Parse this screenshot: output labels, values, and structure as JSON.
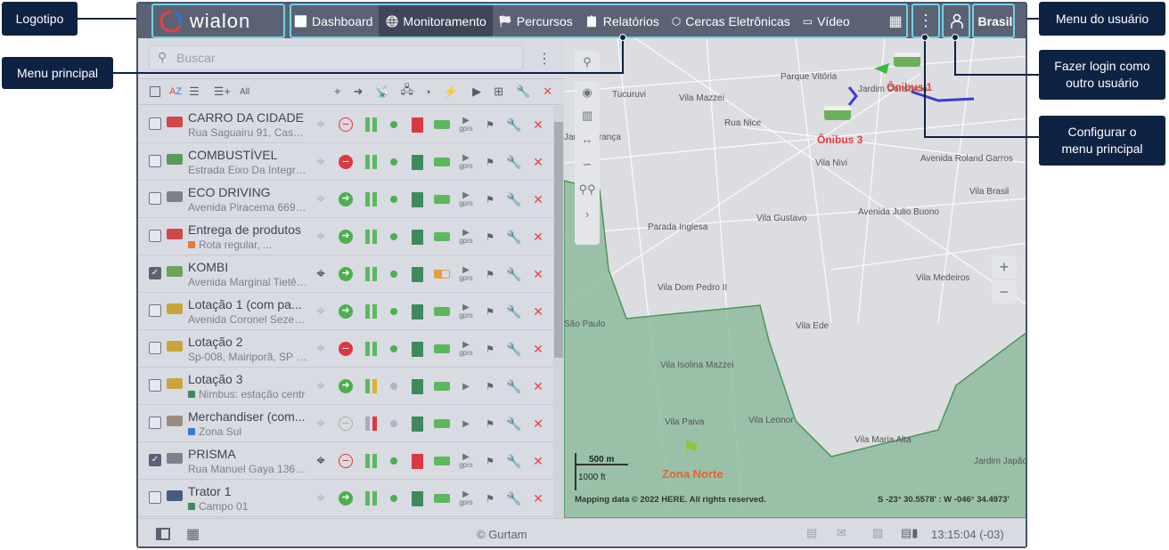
{
  "header": {
    "logo_text": "wialon",
    "nav": [
      {
        "label": "Dashboard",
        "icon": "bar-chart-icon"
      },
      {
        "label": "Monitoramento",
        "icon": "globe-icon",
        "active": true
      },
      {
        "label": "Percursos",
        "icon": "checkered-flag-icon"
      },
      {
        "label": "Relatórios",
        "icon": "report-icon"
      },
      {
        "label": "Cercas Eletrônicas",
        "icon": "geofence-icon"
      },
      {
        "label": "Vídeo",
        "icon": "video-icon"
      }
    ],
    "user": "Brasil"
  },
  "callouts": {
    "logo": "Logotipo",
    "main_menu": "Menu principal",
    "user_menu": "Menu do usuário",
    "login_as": "Fazer login como outro usuário",
    "configure": "Configurar o menu principal"
  },
  "search": {
    "placeholder": "Buscar"
  },
  "units": [
    {
      "name": "CARRO DA CIDADE",
      "address": "Rua Saguairu 91, Casa ...",
      "checked": false,
      "icon_color": "#d04848",
      "arrow": "stop-outline",
      "bars": "green",
      "dot": "green",
      "square": "#d9393f",
      "battery": "full",
      "gprs": true
    },
    {
      "name": "COMBUSTÍVEL",
      "address": "Estrada Eixo Da Integra...",
      "checked": false,
      "icon_color": "#5a9a5a",
      "arrow": "stop-filled",
      "bars": "green",
      "dot": "green",
      "square": "#3f8a5c",
      "battery": "full",
      "gprs": true
    },
    {
      "name": "ECO DRIVING",
      "address": "Avenida Piracema 669, ...",
      "checked": false,
      "icon_color": "#7a8290",
      "arrow": "go",
      "bars": "green",
      "dot": "green",
      "square": "#3f8a5c",
      "battery": "full",
      "gprs": true
    },
    {
      "name": "Entrega de produtos",
      "address": "Rota regular, ...",
      "marker": "#e07b39",
      "checked": false,
      "icon_color": "#d04848",
      "arrow": "go",
      "bars": "green",
      "dot": "green",
      "square": "#3f8a5c",
      "battery": "full",
      "gprs": true
    },
    {
      "name": "KOMBI",
      "address": "Avenida Marginal Tietê,...",
      "checked": true,
      "icon_color": "#6aa35a",
      "arrow": "go",
      "bars": "green",
      "dot": "green",
      "square": "#3f8a5c",
      "battery": "half",
      "gprs": true
    },
    {
      "name": "Lotação 1 (com pa...",
      "address": "Avenida Coronel Sezefr...",
      "checked": false,
      "icon_color": "#c9a43a",
      "arrow": "go",
      "bars": "green",
      "dot": "green",
      "square": "#3f8a5c",
      "battery": "full",
      "gprs": true
    },
    {
      "name": "Lotação 2",
      "address": "Sp-008, Mairiporã, SP 0...",
      "checked": false,
      "icon_color": "#c9a43a",
      "arrow": "stop-filled",
      "bars": "green",
      "dot": "green",
      "square": "#3f8a5c",
      "battery": "full",
      "gprs": true
    },
    {
      "name": "Lotação 3",
      "address": "Nimbus: estação centr",
      "marker": "#3f8a5c",
      "checked": false,
      "icon_color": "#c9a43a",
      "arrow": "go",
      "bars": "green-yellow",
      "dot": "gray",
      "square": "#3f8a5c",
      "battery": "full",
      "gprs": false
    },
    {
      "name": "Merchandiser (com...",
      "address": "Zona Sul",
      "marker": "#3a7bd5",
      "checked": false,
      "icon_color": "#9a8c80",
      "arrow": "stop-gray",
      "bars": "gray-red",
      "dot": "gray",
      "square": "#3f8a5c",
      "battery": "full",
      "gprs": false
    },
    {
      "name": "PRISMA",
      "address": "Rua Manuel Gaya 1364...",
      "checked": true,
      "icon_color": "#7a8290",
      "arrow": "stop-outline",
      "bars": "green",
      "dot": "green",
      "square": "#d9393f",
      "battery": "full",
      "gprs": true
    },
    {
      "name": "Trator 1",
      "address": "Campo 01",
      "marker": "#3f8a5c",
      "checked": false,
      "icon_color": "#4a5a80",
      "arrow": "go",
      "bars": "green",
      "dot": "green",
      "square": "#3f8a5c",
      "battery": "full",
      "gprs": true
    }
  ],
  "gprs_label": "gprs",
  "map": {
    "labels": [
      "Parque Vitória",
      "Vila Mazzei",
      "Tucuruvi",
      "Jardim França",
      "Vila Nivi",
      "Parada Inglesa",
      "Vila Gustavo",
      "Avenida Julio Buono",
      "Avenida Roland Garros",
      "Vila Brasil",
      "Vila Dom Pedro II",
      "Vila Medeiros",
      "Vila Ede",
      "Vila Isolina Mazzei",
      "Vila Paiva",
      "Vila Leonor",
      "Vila Maria Alta",
      "Jardim Japão",
      "Rua Nice",
      "Jardim Consórcio",
      "São Paulo"
    ],
    "units": [
      "Ônibus 1",
      "Ônibus 3"
    ],
    "geofence": "Zona Norte",
    "scale_m": "500 m",
    "scale_ft": "1000 ft",
    "copyright": "Mapping data © 2022 HERE. All rights reserved.",
    "coords": "S -23° 30.5578' : W -046° 34.4973'"
  },
  "footer": {
    "copyright": "© Gurtam",
    "time": "13:15:04 (-03)"
  }
}
